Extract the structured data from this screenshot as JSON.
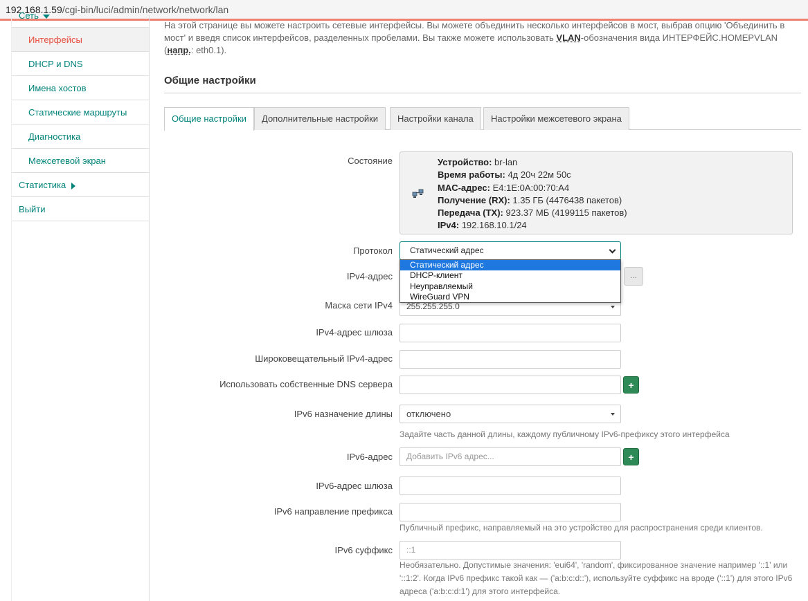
{
  "browser": {
    "url_host": "192.168.1.59",
    "url_path": "/cgi-bin/luci/admin/network/network/lan"
  },
  "sidebar": {
    "network_label": "Сеть",
    "items": [
      {
        "label": "Интерфейсы"
      },
      {
        "label": "DHCP и DNS"
      },
      {
        "label": "Имена хостов"
      },
      {
        "label": "Статические маршруты"
      },
      {
        "label": "Диагностика"
      },
      {
        "label": "Межсетевой экран"
      }
    ],
    "stats_label": "Статистика",
    "logout_label": "Выйти"
  },
  "intro": {
    "line1": "На этой странице вы можете настроить сетевые интерфейсы. Вы можете объединить несколько интерфейсов в мост, выбрав опцию 'Объединить в",
    "line2a": "мост' и введя список интерфейсов, разделенных пробелами. Вы также можете использовать ",
    "vlan": "VLAN",
    "line2b": "-обозначения вида ИНТЕРФЕЙС.НОМЕРVLAN",
    "line3a": "(",
    "example": "напр.",
    "line3b": ": eth0.1)."
  },
  "section_title": "Общие настройки",
  "tabs": [
    {
      "label": "Общие настройки"
    },
    {
      "label": "Дополнительные настройки"
    },
    {
      "label": "Настройки канала"
    },
    {
      "label": "Настройки межсетевого экрана"
    }
  ],
  "status": {
    "label": "Состояние",
    "device_k": "Устройство:",
    "device_v": " br-lan",
    "uptime_k": "Время работы:",
    "uptime_v": " 4д 20ч 22м 50с",
    "mac_k": "MAC-адрес:",
    "mac_v": " E4:1E:0A:00:70:A4",
    "rx_k": "Получение (RX):",
    "rx_v": " 1.35 ГБ (4476438 пакетов)",
    "tx_k": "Передача (TX):",
    "tx_v": " 923.37 МБ (4199115 пакетов)",
    "ipv4_k": "IPv4:",
    "ipv4_v": " 192.168.10.1/24"
  },
  "protocol": {
    "label": "Протокол",
    "value": "Статический адрес",
    "options": [
      "Статический адрес",
      "DHCP-клиент",
      "Неуправляемый",
      "WireGuard VPN"
    ]
  },
  "fields": {
    "ipv4_addr_label": "IPv4-адрес",
    "ipv4_addr_btn": "...",
    "mask_label": "Маска сети IPv4",
    "mask_value": "255.255.255.0",
    "gw_label": "IPv4-адрес шлюза",
    "bcast_label": "Широковещательный IPv4-адрес",
    "dns_label": "Использовать собственные DNS сервера",
    "plus": "+",
    "ip6assign_label": "IPv6 назначение длины",
    "ip6assign_value": "отключено",
    "ip6assign_hint": "Задайте часть данной длины, каждому публичному IPv6-префиксу этого интерфейса",
    "ip6addr_label": "IPv6-адрес",
    "ip6addr_ph": "Добавить IPv6 адрес...",
    "ip6gw_label": "IPv6-адрес шлюза",
    "ip6prefix_label": "IPv6 направление префикса",
    "ip6prefix_hint": "Публичный префикс, направляемый на это устройство для распространения среди клиентов.",
    "ip6suffix_label": "IPv6 суффикс",
    "ip6suffix_ph": "::1",
    "ip6suffix_hint1": "Необязательно. Допустимые значения: 'eui64', 'random', фиксированное значение например '::1' или",
    "ip6suffix_hint2": "'::1:2'. Когда IPv6 префикс такой как — ('a:b:c:d::'), используйте суффикс на вроде ('::1') для этого IPv6",
    "ip6suffix_hint3": "адреса ('a:b:c:d:1') для этого интерфейса."
  }
}
